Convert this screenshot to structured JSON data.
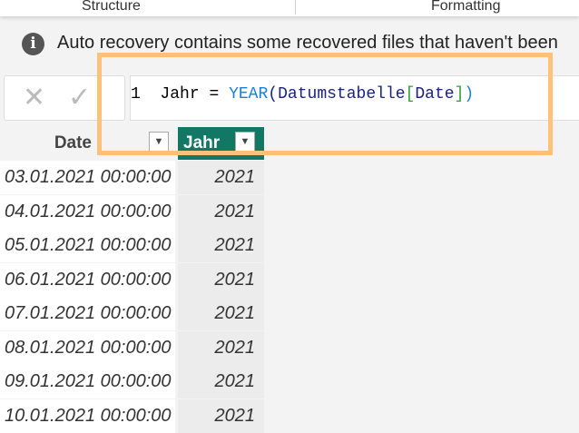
{
  "ribbon": {
    "structure": "Structure",
    "formatting": "Formatting"
  },
  "notification": {
    "message": "Auto recovery contains some recovered files that haven't been",
    "icon": "info-icon"
  },
  "formula_bar": {
    "line_number": "1",
    "name": "Jahr",
    "equals": "=",
    "function": "YEAR",
    "open": "(",
    "table": "Datumstabelle",
    "col_open": "[",
    "column": "Date",
    "col_close": "]",
    "close": ")"
  },
  "table": {
    "columns": [
      "Date",
      "Jahr"
    ],
    "rows": [
      [
        "03.01.2021 00:00:00",
        "2021"
      ],
      [
        "04.01.2021 00:00:00",
        "2021"
      ],
      [
        "05.01.2021 00:00:00",
        "2021"
      ],
      [
        "06.01.2021 00:00:00",
        "2021"
      ],
      [
        "07.01.2021 00:00:00",
        "2021"
      ],
      [
        "08.01.2021 00:00:00",
        "2021"
      ],
      [
        "09.01.2021 00:00:00",
        "2021"
      ],
      [
        "10.01.2021 00:00:00",
        "2021"
      ]
    ]
  },
  "colors": {
    "accent": "#117865",
    "highlight": "#ffc07a"
  }
}
